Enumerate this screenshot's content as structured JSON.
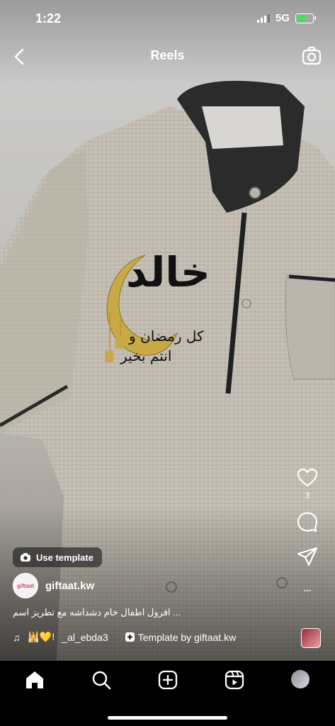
{
  "status": {
    "time": "1:22",
    "network": "5G"
  },
  "header": {
    "title": "Reels",
    "back_icon": "chevron-left-icon",
    "camera_icon": "camera-icon"
  },
  "product": {
    "embroidery_name": "خالد",
    "embroidery_line1": "كل رمضان و",
    "embroidery_line2": "انتم بخير"
  },
  "side": {
    "likes": "3"
  },
  "use_template": {
    "label": "Use template"
  },
  "user": {
    "username": "giftaat.kw",
    "avatar_text": "giftaat"
  },
  "caption": {
    "text": "افرول اطفال خام دشداشه مع تطريز اسم ..."
  },
  "music": {
    "emoji": "🕌💛!",
    "track": "_al_ebda3",
    "template_label": "Template by giftaat.kw"
  },
  "tabs": [
    "home",
    "search",
    "create",
    "reels",
    "profile"
  ],
  "colors": {
    "background": "#000000",
    "text": "#ffffff",
    "battery": "#4cd964"
  }
}
